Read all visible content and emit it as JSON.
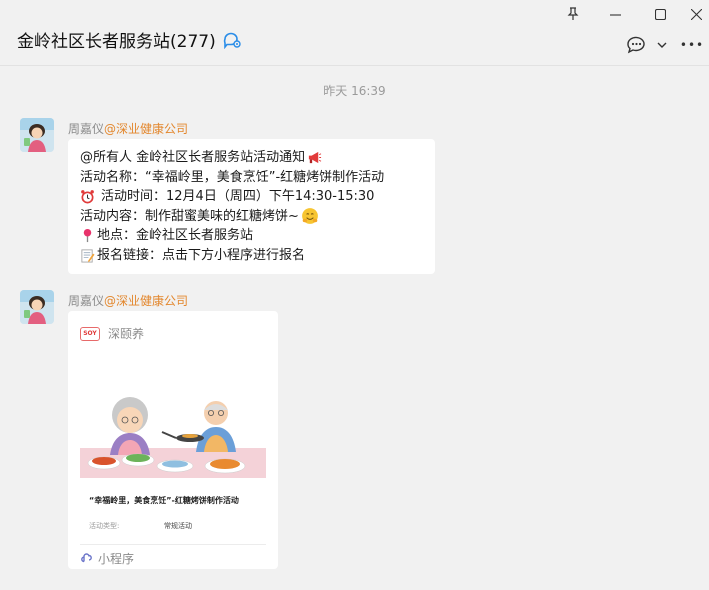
{
  "window": {
    "pin_glyph": "⊥",
    "minimize_glyph": "—",
    "maximize_glyph": "☐",
    "close_glyph": "✕"
  },
  "header": {
    "title": "金岭社区长者服务站(277)",
    "more_glyph": "•••"
  },
  "timestamp": "昨天 16:39",
  "messages": [
    {
      "sender_name": "周嘉仪",
      "sender_org": "@深业健康公司",
      "lines": [
        {
          "icon": "",
          "text": "@所有人 金岭社区长者服务站活动通知",
          "trail_icon": "megaphone-icon"
        },
        {
          "icon": "",
          "text": "活动名称：“幸福岭里，美食烹饪”-红糖烤饼制作活动",
          "trail_icon": ""
        },
        {
          "icon": "alarm-clock-icon",
          "text": "活动时间：12月4日（周四）下午14:30-15:30",
          "trail_icon": ""
        },
        {
          "icon": "",
          "text": "活动内容：制作甜蜜美味的红糖烤饼~",
          "trail_icon": "hug-face-icon"
        },
        {
          "icon": "pushpin-icon",
          "text": "地点：金岭社区长者服务站",
          "trail_icon": ""
        },
        {
          "icon": "memo-icon",
          "text": "报名链接：点击下方小程序进行报名",
          "trail_icon": ""
        }
      ]
    },
    {
      "sender_name": "周嘉仪",
      "sender_org": "@深业健康公司",
      "card": {
        "app_name": "深颐养",
        "app_logo_text": "SOY",
        "title": "“幸福岭里，美食烹饪”-红糖烤饼制作活动",
        "field_key": "活动类型:",
        "field_value": "常规活动",
        "footer": "小程序"
      }
    }
  ],
  "colors": {
    "background": "#f1f1f1",
    "bubble": "#ffffff",
    "org_accent": "#e3872d",
    "muted_text": "#8a8a8a",
    "title_icon_blue": "#2a8de8"
  }
}
